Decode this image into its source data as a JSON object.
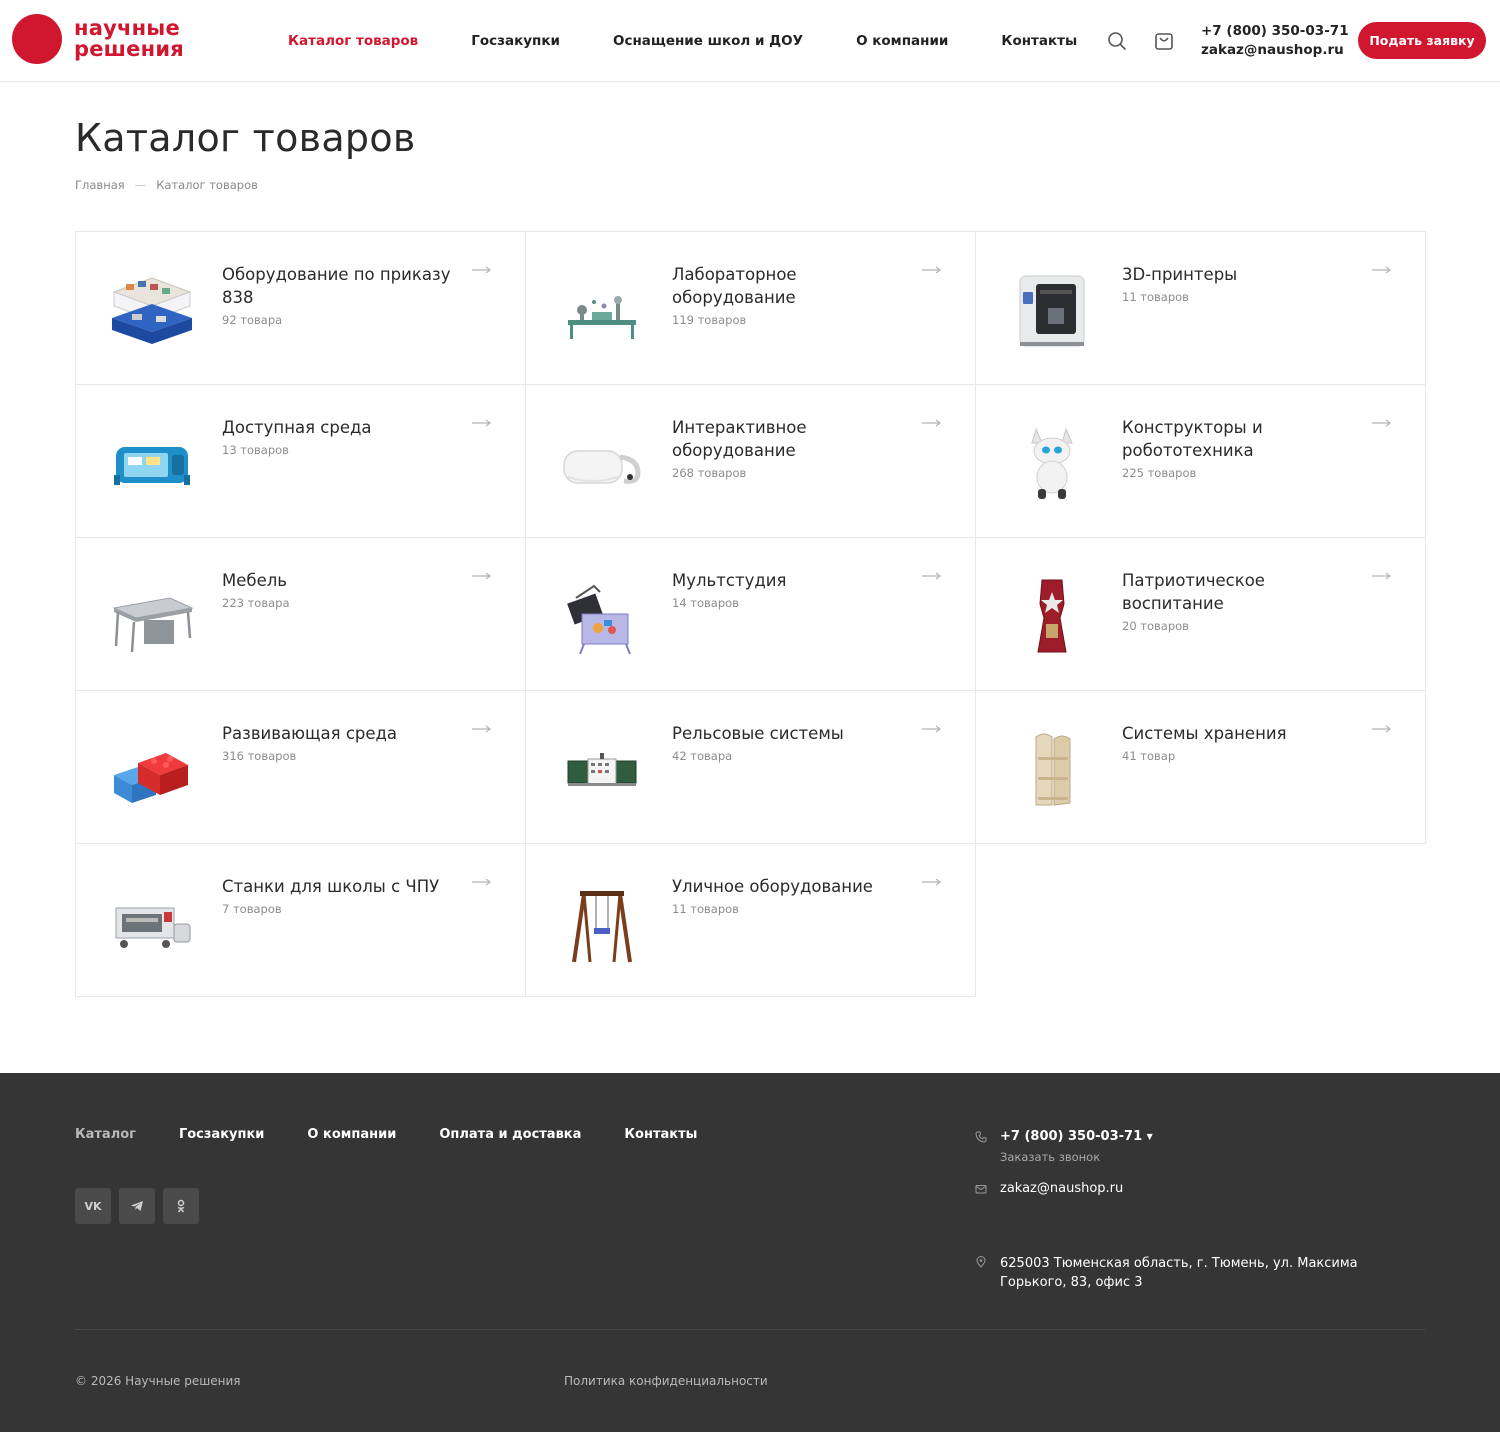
{
  "brand": {
    "line1": "научные",
    "line2": "решения",
    "color": "#d0172f"
  },
  "nav": [
    {
      "label": "Каталог товаров",
      "active": true
    },
    {
      "label": "Госзакупки"
    },
    {
      "label": "Оснащение школ и ДОУ"
    },
    {
      "label": "О компании"
    },
    {
      "label": "Контакты"
    }
  ],
  "header": {
    "search_icon": "search-icon",
    "cart_icon": "cart-icon",
    "phone": "+7 (800) 350-03-71",
    "email": "zakaz@naushop.ru",
    "request_button": "Подать заявку"
  },
  "page": {
    "title": "Каталог товаров",
    "breadcrumb": [
      "Главная",
      "Каталог товаров"
    ]
  },
  "categories": [
    {
      "title": "Оборудование по приказу 838",
      "count": "92 товара",
      "icon": "storage-tray-image"
    },
    {
      "title": "Лабораторное оборудование",
      "count": "119 товаров",
      "icon": "lab-equipment-image"
    },
    {
      "title": "3D-принтеры",
      "count": "11 товаров",
      "icon": "3d-printer-image"
    },
    {
      "title": "Доступная среда",
      "count": "13 товаров",
      "icon": "accessible-tablet-image"
    },
    {
      "title": "Интерактивное оборудование",
      "count": "268 товаров",
      "icon": "vr-headset-image"
    },
    {
      "title": "Конструкторы и робототехника",
      "count": "225 товаров",
      "icon": "robot-dog-image"
    },
    {
      "title": "Мебель",
      "count": "223 товара",
      "icon": "desk-image"
    },
    {
      "title": "Мультстудия",
      "count": "14 товаров",
      "icon": "animation-studio-image"
    },
    {
      "title": "Патриотическое воспитание",
      "count": "20 товаров",
      "icon": "patriotic-stand-image"
    },
    {
      "title": "Развивающая среда",
      "count": "316 товаров",
      "icon": "building-blocks-image"
    },
    {
      "title": "Рельсовые системы",
      "count": "42 товара",
      "icon": "rail-board-image"
    },
    {
      "title": "Системы хранения",
      "count": "41 товар",
      "icon": "shelf-image"
    },
    {
      "title": "Станки для школы с ЧПУ",
      "count": "7 товаров",
      "icon": "cnc-machine-image"
    },
    {
      "title": "Уличное оборудование",
      "count": "11 товаров",
      "icon": "swing-image"
    }
  ],
  "footer": {
    "nav": [
      "Каталог",
      "Госзакупки",
      "О компании",
      "Оплата и доставка",
      "Контакты"
    ],
    "socials": [
      {
        "label": "VK",
        "icon": "vk-icon"
      },
      {
        "label": "Telegram",
        "icon": "telegram-icon"
      },
      {
        "label": "OK",
        "icon": "odnoklassniki-icon"
      }
    ],
    "phone": "+7 (800) 350-03-71",
    "callback": "Заказать звонок",
    "email": "zakaz@naushop.ru",
    "address": "625003 Тюменская область, г. Тюмень, ул. Максима Горького, 83, офис 3",
    "copyright": "© 2026 Научные решения",
    "privacy": "Политика конфиденциальности"
  }
}
